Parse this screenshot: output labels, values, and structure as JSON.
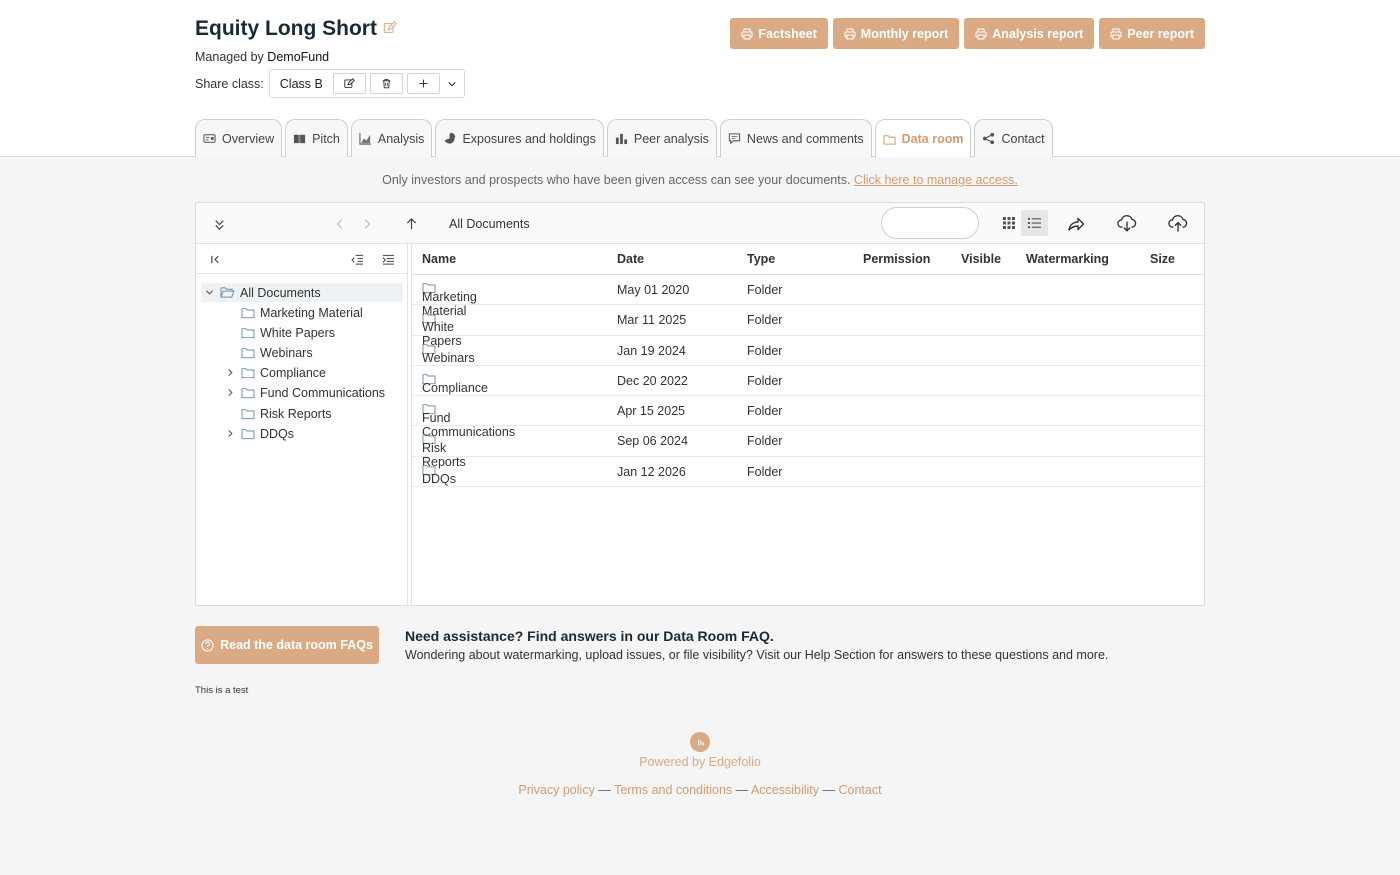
{
  "fund": {
    "title": "Equity Long Short",
    "managed_prefix": "Managed by",
    "manager": "DemoFund",
    "share_class_label": "Share class:",
    "share_class_value": "Class B"
  },
  "reports": [
    {
      "label": "Factsheet",
      "icon": "printer-icon"
    },
    {
      "label": "Monthly report",
      "icon": "printer-icon"
    },
    {
      "label": "Analysis report",
      "icon": "printer-icon"
    },
    {
      "label": "Peer report",
      "icon": "printer-icon"
    }
  ],
  "tabs": [
    {
      "label": "Overview",
      "icon": "card-icon"
    },
    {
      "label": "Pitch",
      "icon": "book-icon"
    },
    {
      "label": "Analysis",
      "icon": "area-chart-icon"
    },
    {
      "label": "Exposures and holdings",
      "icon": "pie-chart-icon"
    },
    {
      "label": "Peer analysis",
      "icon": "bar-chart-icon"
    },
    {
      "label": "News and comments",
      "icon": "comment-icon"
    },
    {
      "label": "Data room",
      "icon": "folder-icon",
      "active": true
    },
    {
      "label": "Contact",
      "icon": "share-icon"
    }
  ],
  "access_note": {
    "text": "Only investors and prospects who have been given access can see your documents.",
    "link": "Click here to manage access."
  },
  "browser": {
    "path": "All Documents",
    "tree": {
      "root": "All Documents",
      "items": [
        "Marketing Material",
        "White Papers",
        "Webinars",
        "Compliance",
        "Fund Communications",
        "Risk Reports",
        "DDQs"
      ]
    },
    "columns": {
      "name": "Name",
      "date": "Date",
      "type": "Type",
      "permission": "Permission",
      "visible": "Visible",
      "watermarking": "Watermarking",
      "size": "Size"
    },
    "rows": [
      {
        "name": "Marketing Material",
        "date": "May 01 2020",
        "type": "Folder"
      },
      {
        "name": "White Papers",
        "date": "Mar 11 2025",
        "type": "Folder"
      },
      {
        "name": "Webinars",
        "date": "Jan 19 2024",
        "type": "Folder"
      },
      {
        "name": "Compliance",
        "date": "Dec 20 2022",
        "type": "Folder"
      },
      {
        "name": "Fund Communications",
        "date": "Apr 15 2025",
        "type": "Folder"
      },
      {
        "name": "Risk Reports",
        "date": "Sep 06 2024",
        "type": "Folder"
      },
      {
        "name": "DDQs",
        "date": "Jan 12 2026",
        "type": "Folder"
      }
    ]
  },
  "help": {
    "button": "Read the data room FAQs",
    "title": "Need assistance? Find answers in our Data Room FAQ.",
    "text": "Wondering about watermarking, upload issues, or file visibility? Visit our Help Section for answers to these questions and more."
  },
  "test_note": "This is a test",
  "footer": {
    "powered": "Powered by Edgefolio",
    "links": [
      "Privacy policy",
      "Terms and conditions",
      "Accessibility",
      "Contact"
    ],
    "separator": " — "
  },
  "colors": {
    "accent": "#d9aa84",
    "accent_text": "#d29c6f"
  }
}
